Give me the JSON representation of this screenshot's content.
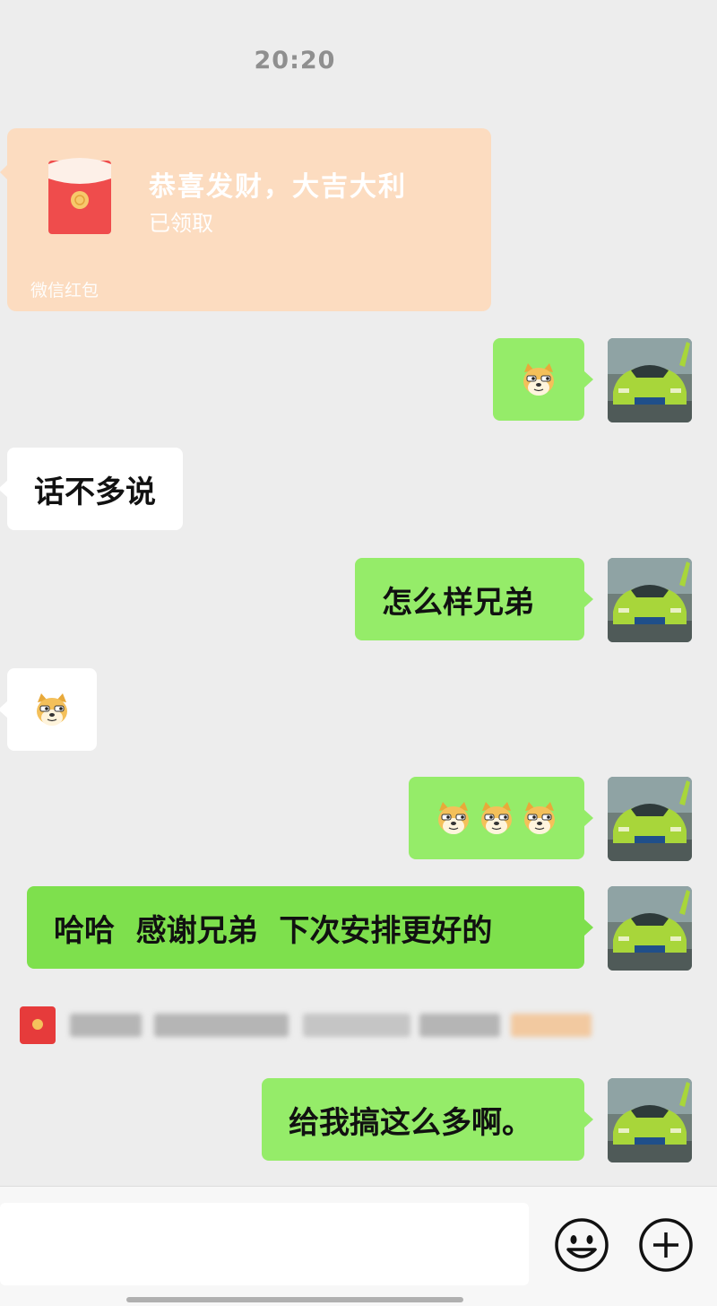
{
  "header": {
    "timestamp": "20:20"
  },
  "red_envelope": {
    "title": "恭喜发财，大吉大利",
    "status": "已领取",
    "footer": "微信红包",
    "colors": {
      "card": "#fcdcc0",
      "envelope": "#ef4c4c",
      "seal": "#f7c96b"
    }
  },
  "messages": [
    {
      "sender": "me",
      "type": "emoji",
      "emojis": [
        "doge-emoji"
      ]
    },
    {
      "sender": "other",
      "type": "text",
      "text": "话不多说"
    },
    {
      "sender": "me",
      "type": "text",
      "text": "怎么样兄弟"
    },
    {
      "sender": "other",
      "type": "emoji",
      "emojis": [
        "doge-emoji"
      ]
    },
    {
      "sender": "me",
      "type": "emoji",
      "emojis": [
        "doge-emoji",
        "doge-emoji",
        "doge-emoji"
      ]
    },
    {
      "sender": "me",
      "type": "text",
      "text": "哈哈  感谢兄弟  下次安排更好的"
    },
    {
      "sender": "me",
      "type": "text",
      "text": "给我搞这么多啊。"
    }
  ],
  "system_notice": {
    "icon": "red-envelope-icon",
    "redacted": true
  },
  "input_bar": {
    "input_value": "",
    "emoji_button_icon": "smiley-face-icon",
    "more_button_icon": "plus-circle-icon"
  },
  "colors": {
    "background": "#ededed",
    "my_bubble": "#95ec69",
    "their_bubble": "#ffffff",
    "avatar_car": "#a8d63a"
  }
}
